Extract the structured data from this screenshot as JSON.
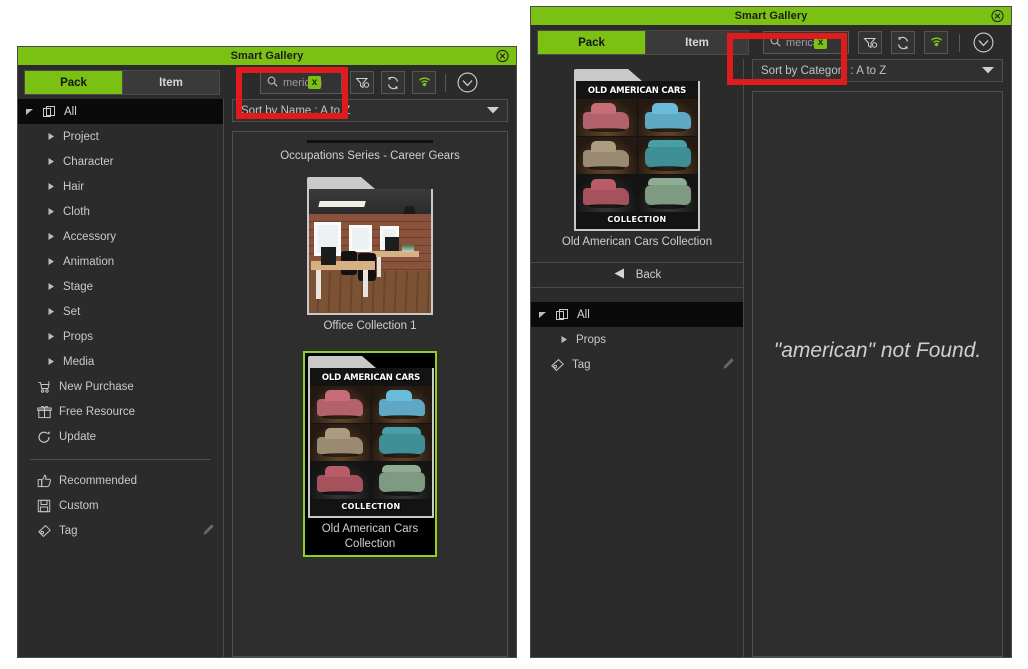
{
  "left_panel": {
    "title": "Smart Gallery",
    "close_icon": "close-circle-icon",
    "tabs": [
      {
        "label": "Pack",
        "active": true
      },
      {
        "label": "Item",
        "active": false
      }
    ],
    "search": {
      "value": "merican",
      "clear_label": "x",
      "icon": "search-icon"
    },
    "toolbar_icons": [
      "filter-settings-icon",
      "refresh-icon",
      "broadcast-icon",
      "chevron-down-circle-icon"
    ],
    "sort": {
      "label": "Sort by Name : A to Z",
      "caret": "chevron-down-icon"
    },
    "tree": {
      "root": {
        "label": "All",
        "icon": "copy-icon",
        "selected": true
      },
      "children": [
        {
          "label": "Project"
        },
        {
          "label": "Character"
        },
        {
          "label": "Hair"
        },
        {
          "label": "Cloth"
        },
        {
          "label": "Accessory"
        },
        {
          "label": "Animation"
        },
        {
          "label": "Stage"
        },
        {
          "label": "Set"
        },
        {
          "label": "Props"
        },
        {
          "label": "Media"
        }
      ],
      "actions": [
        {
          "label": "New Purchase",
          "icon": "cart-icon"
        },
        {
          "label": "Free Resource",
          "icon": "gift-icon"
        },
        {
          "label": "Update",
          "icon": "refresh-arrow-icon"
        }
      ],
      "extras": [
        {
          "label": "Recommended",
          "icon": "thumbs-up-icon"
        },
        {
          "label": "Custom",
          "icon": "save-disk-icon"
        },
        {
          "label": "Tag",
          "icon": "tag-icon",
          "trailing_icon": "pencil-icon"
        }
      ]
    },
    "groups": [
      {
        "title": "Occupations Series - Career Gears",
        "cards": [
          {
            "label": "Office Collection 1",
            "art": "office",
            "selected": false
          }
        ]
      },
      {
        "title": "",
        "cards": [
          {
            "label": "Old American Cars Collection",
            "art": "cars",
            "selected": true
          }
        ]
      }
    ]
  },
  "right_panel": {
    "title": "Smart Gallery",
    "close_icon": "close-circle-icon",
    "tabs": [
      {
        "label": "Pack",
        "active": true
      },
      {
        "label": "Item",
        "active": false
      }
    ],
    "search": {
      "value": "merican",
      "clear_label": "x",
      "icon": "search-icon"
    },
    "toolbar_icons": [
      "filter-settings-icon",
      "refresh-icon",
      "broadcast-icon",
      "chevron-down-circle-icon"
    ],
    "sort": {
      "label": "Sort by Category : A to Z",
      "caret": "chevron-down-icon"
    },
    "pack_preview": {
      "label": "Old American Cars Collection",
      "art": "cars"
    },
    "back": {
      "label": "Back",
      "icon": "back-triangle-icon"
    },
    "tree": {
      "root": {
        "label": "All",
        "icon": "copy-icon",
        "selected": true
      },
      "children": [
        {
          "label": "Props"
        }
      ],
      "extras": [
        {
          "label": "Tag",
          "icon": "tag-icon",
          "trailing_icon": "pencil-icon"
        }
      ]
    },
    "empty_message": "\"american\" not Found."
  },
  "cars_art": {
    "header": "OLD AMERICAN CARS",
    "footer": "COLLECTION"
  },
  "colors": {
    "accent_green": "#7ac114",
    "selection_green": "#8fd11e",
    "highlight_red": "#e01b1b",
    "panel_bg": "#2b2b2b",
    "tree_selected_bg": "#0a0a0a"
  }
}
